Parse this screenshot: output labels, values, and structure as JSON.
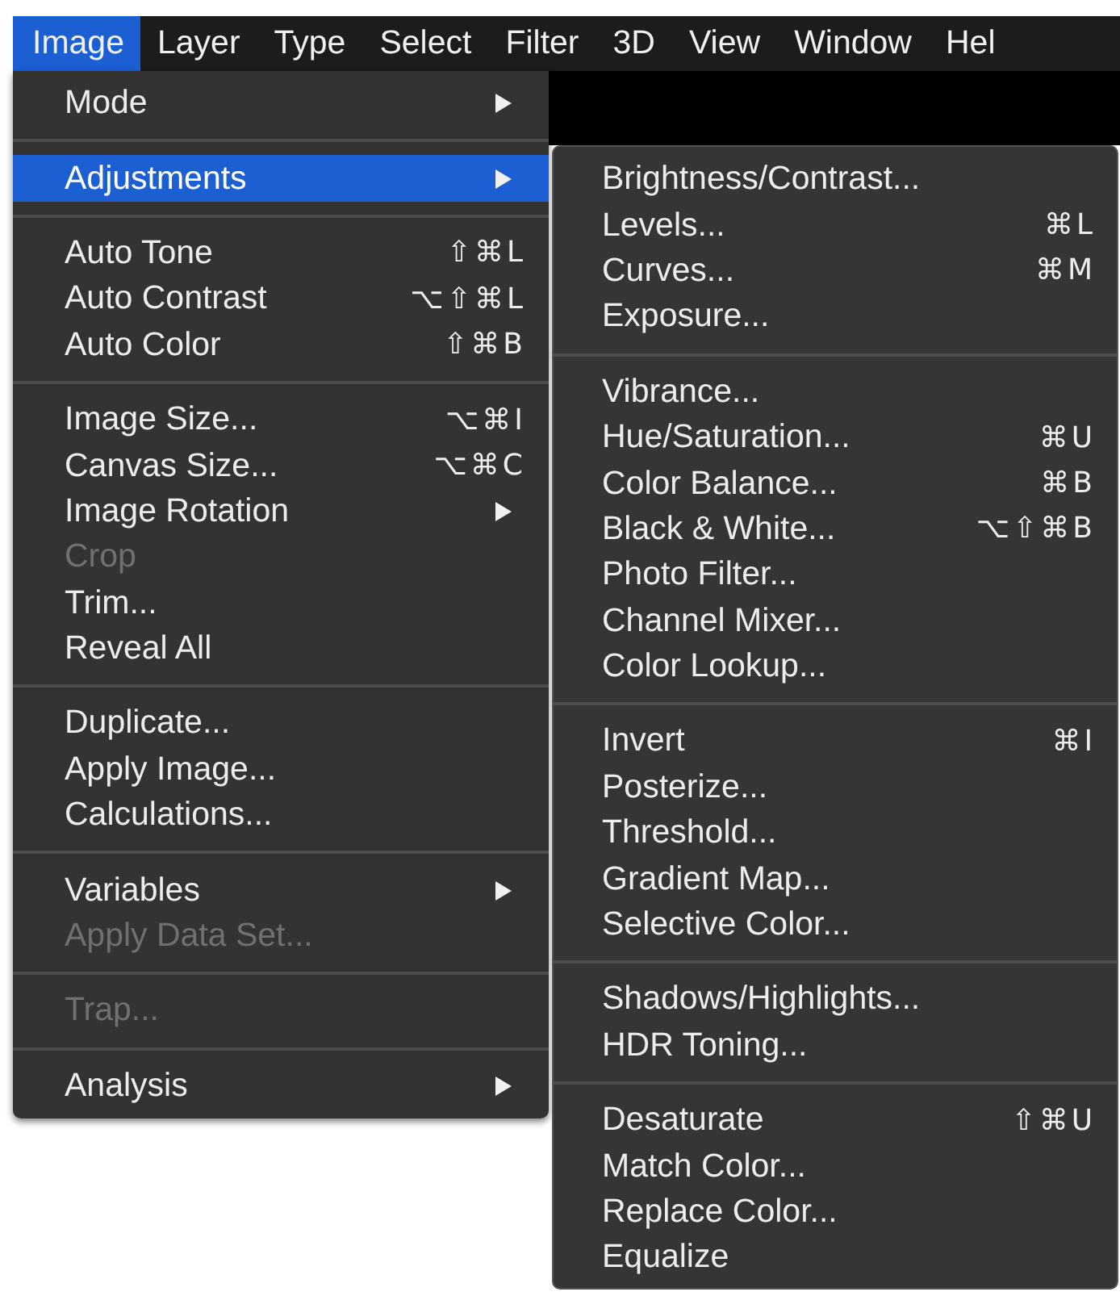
{
  "menu_bar": [
    {
      "label": "Image",
      "selected": true
    },
    {
      "label": "Layer",
      "selected": false
    },
    {
      "label": "Type",
      "selected": false
    },
    {
      "label": "Select",
      "selected": false
    },
    {
      "label": "Filter",
      "selected": false
    },
    {
      "label": "3D",
      "selected": false
    },
    {
      "label": "View",
      "selected": false
    },
    {
      "label": "Window",
      "selected": false
    },
    {
      "label": "Hel",
      "selected": false
    }
  ],
  "image_menu": [
    {
      "kind": "item",
      "label": "Mode",
      "submenu": true,
      "selected": false,
      "disabled": false
    },
    {
      "kind": "separator"
    },
    {
      "kind": "item",
      "label": "Adjustments",
      "submenu": true,
      "selected": true,
      "disabled": false
    },
    {
      "kind": "separator"
    },
    {
      "kind": "item",
      "label": "Auto Tone",
      "shortcut": "⇧⌘L",
      "selected": false,
      "disabled": false
    },
    {
      "kind": "item",
      "label": "Auto Contrast",
      "shortcut": "⌥⇧⌘L",
      "selected": false,
      "disabled": false
    },
    {
      "kind": "item",
      "label": "Auto Color",
      "shortcut": "⇧⌘B",
      "selected": false,
      "disabled": false
    },
    {
      "kind": "separator"
    },
    {
      "kind": "item",
      "label": "Image Size...",
      "shortcut": "⌥⌘I",
      "selected": false,
      "disabled": false
    },
    {
      "kind": "item",
      "label": "Canvas Size...",
      "shortcut": "⌥⌘C",
      "selected": false,
      "disabled": false
    },
    {
      "kind": "item",
      "label": "Image Rotation",
      "submenu": true,
      "selected": false,
      "disabled": false
    },
    {
      "kind": "item",
      "label": "Crop",
      "selected": false,
      "disabled": true
    },
    {
      "kind": "item",
      "label": "Trim...",
      "selected": false,
      "disabled": false
    },
    {
      "kind": "item",
      "label": "Reveal All",
      "selected": false,
      "disabled": false
    },
    {
      "kind": "separator"
    },
    {
      "kind": "item",
      "label": "Duplicate...",
      "selected": false,
      "disabled": false
    },
    {
      "kind": "item",
      "label": "Apply Image...",
      "selected": false,
      "disabled": false
    },
    {
      "kind": "item",
      "label": "Calculations...",
      "selected": false,
      "disabled": false
    },
    {
      "kind": "separator"
    },
    {
      "kind": "item",
      "label": "Variables",
      "submenu": true,
      "selected": false,
      "disabled": false
    },
    {
      "kind": "item",
      "label": "Apply Data Set...",
      "selected": false,
      "disabled": true
    },
    {
      "kind": "separator"
    },
    {
      "kind": "item",
      "label": "Trap...",
      "selected": false,
      "disabled": true
    },
    {
      "kind": "separator"
    },
    {
      "kind": "item",
      "label": "Analysis",
      "submenu": true,
      "selected": false,
      "disabled": false
    }
  ],
  "adjustments_menu": [
    {
      "kind": "item",
      "label": "Brightness/Contrast...",
      "selected": false,
      "disabled": false
    },
    {
      "kind": "item",
      "label": "Levels...",
      "shortcut": "⌘L",
      "selected": false,
      "disabled": false
    },
    {
      "kind": "item",
      "label": "Curves...",
      "shortcut": "⌘M",
      "selected": false,
      "disabled": false
    },
    {
      "kind": "item",
      "label": "Exposure...",
      "selected": false,
      "disabled": false
    },
    {
      "kind": "separator"
    },
    {
      "kind": "item",
      "label": "Vibrance...",
      "selected": false,
      "disabled": false
    },
    {
      "kind": "item",
      "label": "Hue/Saturation...",
      "shortcut": "⌘U",
      "selected": false,
      "disabled": false
    },
    {
      "kind": "item",
      "label": "Color Balance...",
      "shortcut": "⌘B",
      "selected": false,
      "disabled": false
    },
    {
      "kind": "item",
      "label": "Black & White...",
      "shortcut": "⌥⇧⌘B",
      "selected": false,
      "disabled": false
    },
    {
      "kind": "item",
      "label": "Photo Filter...",
      "selected": false,
      "disabled": false
    },
    {
      "kind": "item",
      "label": "Channel Mixer...",
      "selected": false,
      "disabled": false
    },
    {
      "kind": "item",
      "label": "Color Lookup...",
      "selected": false,
      "disabled": false
    },
    {
      "kind": "separator"
    },
    {
      "kind": "item",
      "label": "Invert",
      "shortcut": "⌘I",
      "selected": false,
      "disabled": false
    },
    {
      "kind": "item",
      "label": "Posterize...",
      "selected": false,
      "disabled": false
    },
    {
      "kind": "item",
      "label": "Threshold...",
      "selected": false,
      "disabled": false
    },
    {
      "kind": "item",
      "label": "Gradient Map...",
      "selected": false,
      "disabled": false
    },
    {
      "kind": "item",
      "label": "Selective Color...",
      "selected": false,
      "disabled": false
    },
    {
      "kind": "separator"
    },
    {
      "kind": "item",
      "label": "Shadows/Highlights...",
      "selected": false,
      "disabled": false
    },
    {
      "kind": "item",
      "label": "HDR Toning...",
      "selected": false,
      "disabled": false
    },
    {
      "kind": "separator"
    },
    {
      "kind": "item",
      "label": "Desaturate",
      "shortcut": "⇧⌘U",
      "selected": false,
      "disabled": false
    },
    {
      "kind": "item",
      "label": "Match Color...",
      "selected": false,
      "disabled": false
    },
    {
      "kind": "item",
      "label": "Replace Color...",
      "selected": false,
      "disabled": false
    },
    {
      "kind": "item",
      "label": "Equalize",
      "selected": false,
      "disabled": false
    }
  ]
}
